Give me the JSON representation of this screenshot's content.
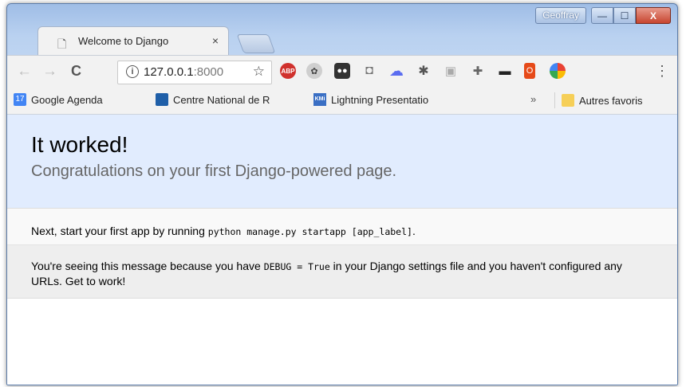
{
  "window": {
    "profile_name": "Geoffray",
    "controls": {
      "minimize": "—",
      "maximize": "☐",
      "close": "X"
    }
  },
  "tab": {
    "title": "Welcome to Django",
    "close": "×"
  },
  "toolbar": {
    "back": "←",
    "forward": "→",
    "reload": "C",
    "url_host": "127.0.0.1",
    "url_port": ":8000",
    "star": "☆",
    "menu": "⋮",
    "extensions": [
      "adblock-icon",
      "film-reel-icon",
      "tampermonkey-icon",
      "camera-icon",
      "cloud-icon",
      "bug-icon",
      "image-icon",
      "puzzle-icon",
      "incognito-icon",
      "office-icon",
      "color-wheel-icon"
    ],
    "abp_label": "ABP"
  },
  "bookmarks": {
    "items": [
      {
        "label": "Google Agenda",
        "icon": "calendar-icon",
        "badge": "17"
      },
      {
        "label": "Centre National de R",
        "icon": "cnr-icon"
      },
      {
        "label": "Lightning Presentatio",
        "icon": "kmi-icon",
        "badge": "KMi"
      }
    ],
    "overflow": "»",
    "other": "Autres favoris"
  },
  "page": {
    "title": "It worked!",
    "subtitle": "Congratulations on your first Django-powered page.",
    "instructions_prefix": "Next, start your first app by running ",
    "instructions_code": "python manage.py startapp [app_label]",
    "instructions_suffix": ".",
    "explanation_prefix": "You're seeing this message because you have ",
    "explanation_code": "DEBUG = True",
    "explanation_suffix": " in your Django settings file and you haven't configured any URLs. Get to work!"
  },
  "colors": {
    "header_bg": "#e1ecfe",
    "instructions_bg": "#f9f9f9",
    "explanation_bg": "#eeeeee",
    "subtitle": "#666666"
  }
}
